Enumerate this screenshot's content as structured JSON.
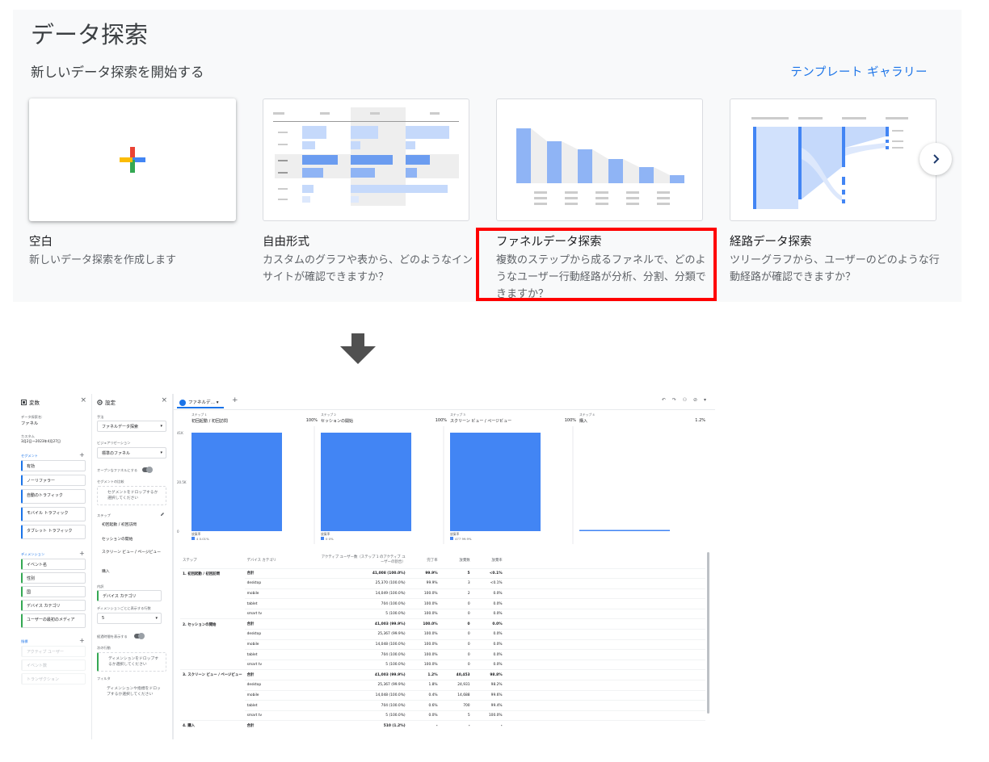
{
  "header": {
    "title": "データ探索",
    "subtitle": "新しいデータ探索を開始する",
    "gallery_link": "テンプレート ギャラリー"
  },
  "templates": [
    {
      "title": "空白",
      "desc": "新しいデータ探索を作成します"
    },
    {
      "title": "自由形式",
      "desc": "カスタムのグラフや表から、どのようなインサイトが確認できますか？"
    },
    {
      "title": "ファネルデータ探索",
      "desc": "複数のステップから成るファネルで、どのようなユーザー行動経路が分析、分割、分類できますか？"
    },
    {
      "title": "経路データ探索",
      "desc": "ツリーグラフから、ユーザーのどのような行動経路が確認できますか？"
    }
  ],
  "icons": {
    "next": "chevron-right-icon",
    "arrow": "arrow-down-icon",
    "add": "plus-icon"
  },
  "colors": {
    "accent": "#1a73e8",
    "bar": "#4285f4",
    "highlight": "#ff0000"
  },
  "variables_panel": {
    "title": "変数",
    "name_label": "データ探索名:",
    "name_value": "ファネル",
    "date_label": "カスタム",
    "date_value": "3月2日～2023年4月27日",
    "segments_label": "セグメント",
    "segments": [
      "有効",
      "ノーリファラー",
      "自動のトラフィック",
      "モバイル トラフィック",
      "タブレット トラフィック"
    ],
    "dimensions_label": "ディメンション",
    "dimensions": [
      "イベント名",
      "性別",
      "国",
      "デバイス カテゴリ",
      "ユーザーの最初のメディア"
    ],
    "metrics_label": "指標",
    "metrics": [
      "アクティブ ユーザー",
      "イベント数",
      "トランザクション"
    ]
  },
  "settings_panel": {
    "title": "設定",
    "technique_label": "手法",
    "technique_value": "ファネルデータ探索",
    "viz_label": "ビジュアリゼーション",
    "viz_value": "標準のファネル",
    "open_funnel_label": "オープンなファネルにする",
    "segment_compare_label": "セグメントの比較",
    "segment_drop": "セグメントをドロップするか選択してください",
    "steps_label": "ステップ",
    "steps": [
      "初回起動 / 初回訪問",
      "セッションの開始",
      "スクリーン ビュー / ページビュー",
      "購入"
    ],
    "breakdown_label": "内訳",
    "breakdown_value": "デバイス カテゴリ",
    "rows_label": "ディメンションごとに表示する行数",
    "rows_value": "5",
    "elapsed_label": "経過時間を表示する",
    "next_action_label": "次の行動",
    "next_action_drop": "ディメンションをドロップするか選択してください",
    "filter_label": "フィルタ",
    "filter_drop": "ディメンションや指標をドロップするか選択してください"
  },
  "report": {
    "tab_label": "ファネルデ…",
    "step_label": "ステップ",
    "steps": [
      {
        "num": "ステップ 1",
        "name": "初回起動 / 初回訪問",
        "pct": "100%"
      },
      {
        "num": "ステップ 2",
        "name": "セッションの開始",
        "pct": "100%"
      },
      {
        "num": "ステップ 3",
        "name": "スクリーン ビュー / ページビュー",
        "pct": "100%"
      },
      {
        "num": "ステップ 4",
        "name": "購入",
        "pct": "1.2%"
      }
    ],
    "y_ticks": [
      "41K",
      "20.5K",
      "0"
    ],
    "abandon_label": "放棄率",
    "abandon_vals": [
      "4  0.01%",
      "0  0%",
      "477  99.9%"
    ],
    "columns": [
      "ステップ",
      "デバイス カテゴリ",
      "アクティブ ユーザー数（ステップ 1 のアクティブ ユーザーの割合）",
      "完了率",
      "放棄数",
      "放棄率"
    ],
    "rows": [
      [
        "1. 初回起動 / 初回訪問",
        "合計",
        "41,008 (100.0%)",
        "99.9%",
        "5",
        "<0.1%"
      ],
      [
        "",
        "desktop",
        "25,370 (100.0%)",
        "99.9%",
        "3",
        "<0.1%"
      ],
      [
        "",
        "mobile",
        "14,049 (100.0%)",
        "100.0%",
        "2",
        "0.0%"
      ],
      [
        "",
        "tablet",
        "704 (100.0%)",
        "100.0%",
        "0",
        "0.0%"
      ],
      [
        "",
        "smart tv",
        "5 (100.0%)",
        "100.0%",
        "0",
        "0.0%"
      ],
      [
        "2. セッションの開始",
        "合計",
        "41,003 (99.9%)",
        "100.0%",
        "0",
        "0.0%"
      ],
      [
        "",
        "desktop",
        "25,367 (99.9%)",
        "100.0%",
        "0",
        "0.0%"
      ],
      [
        "",
        "mobile",
        "14,048 (100.0%)",
        "100.0%",
        "0",
        "0.0%"
      ],
      [
        "",
        "tablet",
        "704 (100.0%)",
        "100.0%",
        "0",
        "0.0%"
      ],
      [
        "",
        "smart tv",
        "5 (100.0%)",
        "100.0%",
        "0",
        "0.0%"
      ],
      [
        "3. スクリーン ビュー / ページビュー",
        "合計",
        "41,003 (99.9%)",
        "1.2%",
        "40,453",
        "98.8%"
      ],
      [
        "",
        "desktop",
        "25,367 (99.9%)",
        "1.8%",
        "24,931",
        "98.2%"
      ],
      [
        "",
        "mobile",
        "14,048 (100.0%)",
        "0.4%",
        "14,688",
        "99.6%"
      ],
      [
        "",
        "tablet",
        "704 (100.0%)",
        "0.6%",
        "700",
        "99.4%"
      ],
      [
        "",
        "smart tv",
        "5 (100.0%)",
        "0.0%",
        "5",
        "100.0%"
      ],
      [
        "4. 購入",
        "合計",
        "510 (1.2%)",
        "-",
        "-",
        "-"
      ]
    ]
  },
  "chart_data": {
    "type": "bar",
    "categories": [
      "初回起動 / 初回訪問",
      "セッションの開始",
      "スクリーン ビュー / ページビュー",
      "購入"
    ],
    "values": [
      41008,
      41003,
      41003,
      510
    ],
    "ylim": [
      0,
      41000
    ],
    "y_ticks": [
      "41K",
      "20.5K",
      "0"
    ],
    "grid": false
  }
}
